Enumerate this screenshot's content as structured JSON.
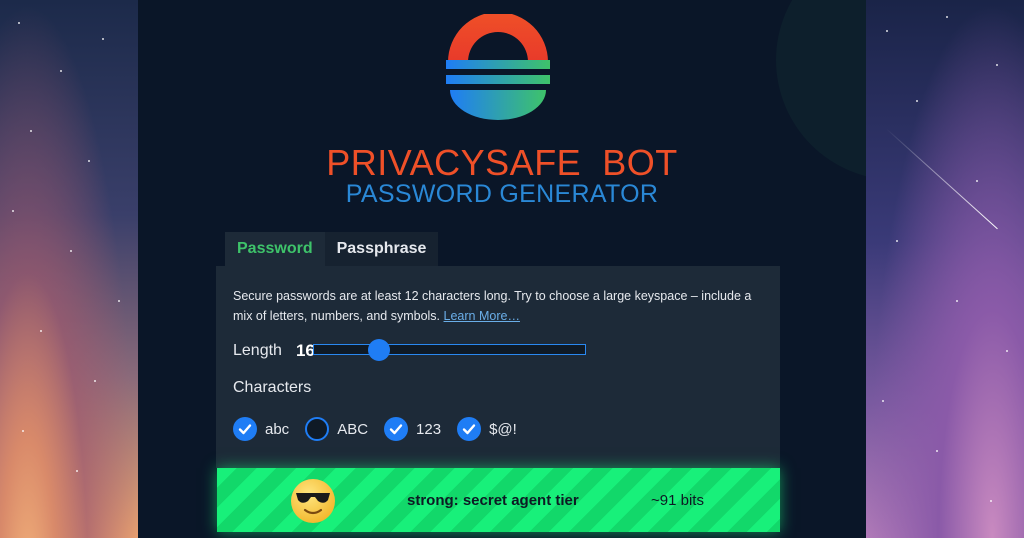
{
  "brand": {
    "title": "PRIVACYSAFE  BOT",
    "subtitle": "PASSWORD GENERATOR"
  },
  "tabs": [
    {
      "label": "Password",
      "active": true
    },
    {
      "label": "Passphrase",
      "active": false
    }
  ],
  "description": {
    "text": "Secure passwords are at least 12 characters long. Try to choose a large keyspace – include a mix of letters, numbers, and symbols.",
    "link": "Learn More…"
  },
  "length": {
    "label": "Length",
    "value": "16",
    "slider_fraction": 0.24
  },
  "characters": {
    "label": "Characters",
    "options": [
      {
        "label": "abc",
        "checked": true
      },
      {
        "label": "ABC",
        "checked": false
      },
      {
        "label": "123",
        "checked": true
      },
      {
        "label": "$@!",
        "checked": true
      }
    ]
  },
  "strength": {
    "text": "strong: secret agent tier",
    "bits": "~91 bits",
    "emoji": "sunglasses-face-icon"
  },
  "colors": {
    "brand_orange": "#ef5028",
    "brand_blue": "#2a88d6",
    "accent_green": "#3ec36a",
    "checkbox_blue": "#1f7df5",
    "strength_green": "#18f07a"
  }
}
